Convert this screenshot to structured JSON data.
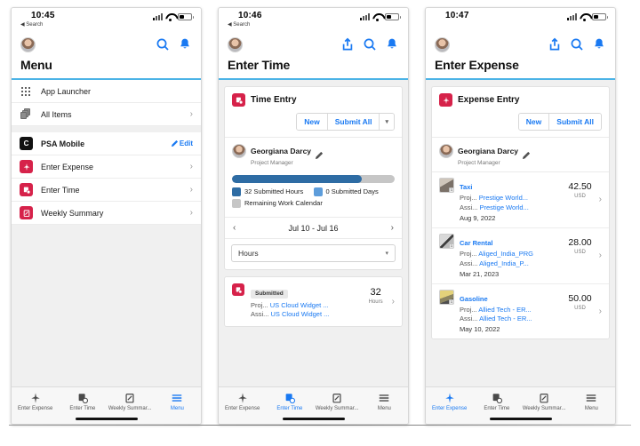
{
  "colors": {
    "accent_blue": "#1979f2",
    "brand_red": "#d6224a",
    "rule_blue": "#4bb3e6",
    "progress_dark_blue": "#2e6ca4",
    "progress_light_blue": "#5d9ddb",
    "progress_gray": "#c6c6c6"
  },
  "phone1": {
    "status": {
      "time": "10:45",
      "back_label": "Search",
      "back_icon": "triangle-left-icon"
    },
    "header": {
      "avatar": "user-avatar",
      "icons": [
        "search-icon",
        "notification-bell-icon"
      ],
      "title": "Menu"
    },
    "menu_groups": [
      {
        "items": [
          {
            "label": "App Launcher",
            "icon": "app-launcher-grid-icon",
            "chevron": false,
            "bold": false
          },
          {
            "label": "All Items",
            "icon": "all-items-stack-icon",
            "chevron": true,
            "bold": false
          }
        ]
      },
      {
        "items": [
          {
            "label": "PSA Mobile",
            "icon": "psa-mobile-app-icon",
            "chevron": false,
            "bold": true,
            "action": "Edit",
            "action_icon": "pencil-icon"
          },
          {
            "label": "Enter Expense",
            "icon": "enter-expense-app-icon",
            "chevron": true,
            "bold": false
          },
          {
            "label": "Enter Time",
            "icon": "enter-time-app-icon",
            "chevron": true,
            "bold": false
          },
          {
            "label": "Weekly Summary",
            "icon": "weekly-summary-app-icon",
            "chevron": true,
            "bold": false
          }
        ]
      }
    ],
    "tabs": [
      {
        "label": "Enter Expense",
        "icon": "enter-expense-icon",
        "active": false
      },
      {
        "label": "Enter Time",
        "icon": "enter-time-icon",
        "active": false
      },
      {
        "label": "Weekly Summar...",
        "icon": "weekly-summary-icon",
        "active": false
      },
      {
        "label": "Menu",
        "icon": "hamburger-menu-icon",
        "active": true
      }
    ]
  },
  "phone2": {
    "status": {
      "time": "10:46",
      "back_label": "Search",
      "back_icon": "triangle-left-icon"
    },
    "header": {
      "avatar": "user-avatar",
      "icons": [
        "share-icon",
        "search-icon",
        "notification-bell-icon"
      ],
      "title": "Enter Time"
    },
    "card": {
      "icon": "time-entry-icon",
      "title": "Time Entry",
      "buttons": {
        "new": "New",
        "submit_all": "Submit All",
        "caret": "▾"
      }
    },
    "user": {
      "name": "Georgiana Darcy",
      "role": "Project Manager",
      "edit_icon": "pencil-icon"
    },
    "progress": {
      "percent": 80,
      "legend": [
        {
          "label": "32 Submitted Hours",
          "color": "#2e6ca4"
        },
        {
          "label": "0 Submitted Days",
          "color": "#5d9ddb"
        },
        {
          "label": "Remaining Work Calendar",
          "color": "#c6c6c6"
        }
      ]
    },
    "date_nav": {
      "prev": "‹",
      "range": "Jul 10 - Jul 16",
      "next": "›"
    },
    "unit_select": {
      "value": "Hours",
      "caret": "▾"
    },
    "entry": {
      "icon": "time-entry-icon",
      "status_badge": "Submitted",
      "project_key": "Proj...",
      "project_value": "US Cloud Widget ...",
      "assignment_key": "Assi...",
      "assignment_value": "US Cloud Widget ...",
      "amount": "32",
      "unit": "Hours",
      "chevron": "›"
    },
    "tabs": [
      {
        "label": "Enter Expense",
        "icon": "enter-expense-icon",
        "active": false
      },
      {
        "label": "Enter Time",
        "icon": "enter-time-icon",
        "active": true
      },
      {
        "label": "Weekly Summar...",
        "icon": "weekly-summary-icon",
        "active": false
      },
      {
        "label": "Menu",
        "icon": "hamburger-menu-icon",
        "active": false
      }
    ]
  },
  "phone3": {
    "status": {
      "time": "10:47",
      "back_label": "",
      "back_icon": ""
    },
    "header": {
      "avatar": "user-avatar",
      "icons": [
        "share-icon",
        "search-icon",
        "notification-bell-icon"
      ],
      "title": "Enter Expense"
    },
    "card": {
      "icon": "expense-entry-icon",
      "title": "Expense Entry",
      "buttons": {
        "new": "New",
        "submit_all": "Submit All"
      }
    },
    "user": {
      "name": "Georgiana Darcy",
      "role": "Project Manager",
      "edit_icon": "pencil-icon"
    },
    "expenses": [
      {
        "name": "Taxi",
        "thumb": "taxi-receipt-thumbnail",
        "thumb_badge": "1",
        "project_key": "Proj...",
        "project_value": "Prestige World...",
        "assignment_key": "Assi...",
        "assignment_value": "Prestige World...",
        "date": "Aug 9, 2022",
        "amount": "42.50",
        "currency": "USD",
        "chevron": "›"
      },
      {
        "name": "Car Rental",
        "thumb": "car-rental-receipt-thumbnail",
        "thumb_badge": "1",
        "project_key": "Proj...",
        "project_value": "Aliged_India_PRG",
        "assignment_key": "Assi...",
        "assignment_value": "Aliged_India_P...",
        "date": "Mar 21, 2023",
        "amount": "28.00",
        "currency": "USD",
        "chevron": "›"
      },
      {
        "name": "Gasoline",
        "thumb": "gasoline-receipt-thumbnail",
        "thumb_badge": "1",
        "project_key": "Proj...",
        "project_value": "Allied Tech - ER...",
        "assignment_key": "Assi...",
        "assignment_value": "Allied Tech - ER...",
        "date": "May 10, 2022",
        "amount": "50.00",
        "currency": "USD",
        "chevron": "›"
      }
    ],
    "tabs": [
      {
        "label": "Enter Expense",
        "icon": "enter-expense-icon",
        "active": true
      },
      {
        "label": "Enter Time",
        "icon": "enter-time-icon",
        "active": false
      },
      {
        "label": "Weekly Summar...",
        "icon": "weekly-summary-icon",
        "active": false
      },
      {
        "label": "Menu",
        "icon": "hamburger-menu-icon",
        "active": false
      }
    ]
  }
}
